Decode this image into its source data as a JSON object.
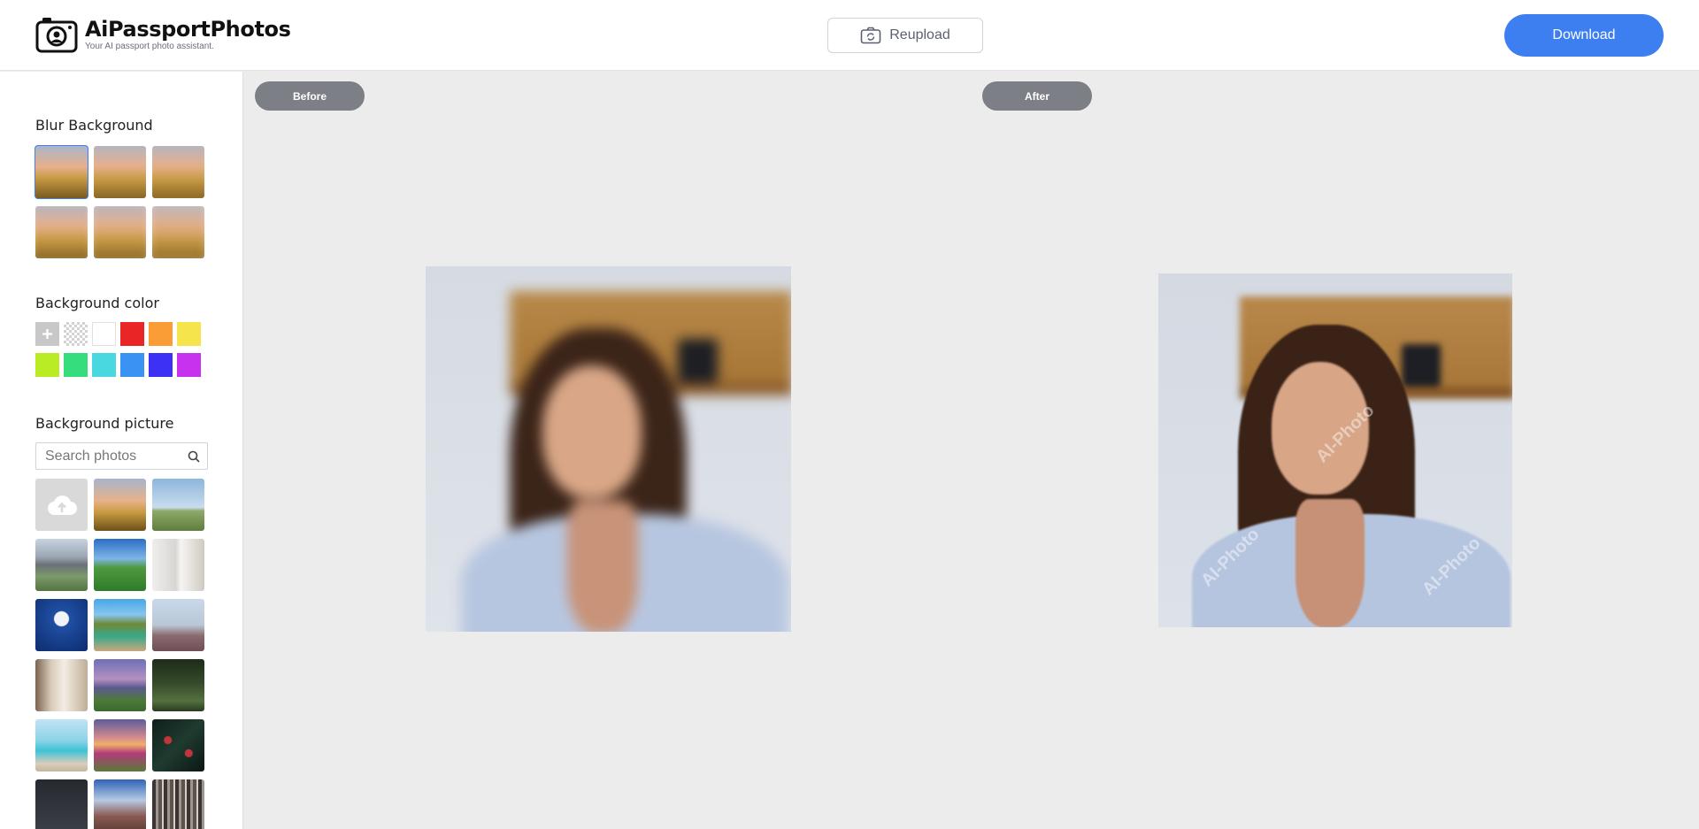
{
  "header": {
    "brand_name": "AiPassportPhotos",
    "brand_tagline": "Your AI passport photo assistant.",
    "reupload_label": "Reupload",
    "download_label": "Download"
  },
  "sidebar": {
    "blur_title": "Blur Background",
    "blur_levels": 6,
    "color_title": "Background color",
    "colors": [
      "#ffffff",
      "#ea2525",
      "#fb9d37",
      "#f6e44c",
      "#b9ec25",
      "#36dd7d",
      "#49d8e0",
      "#3a93f2",
      "#3c31f4",
      "#c632ee"
    ],
    "picture_title": "Background picture",
    "search_placeholder": "Search photos"
  },
  "main": {
    "before_label": "Before",
    "after_label": "After",
    "watermark_text": "AI-Photo"
  },
  "colors": {
    "accent": "#3d7ef0",
    "pill": "#7c7f86",
    "canvas": "#ececec"
  }
}
